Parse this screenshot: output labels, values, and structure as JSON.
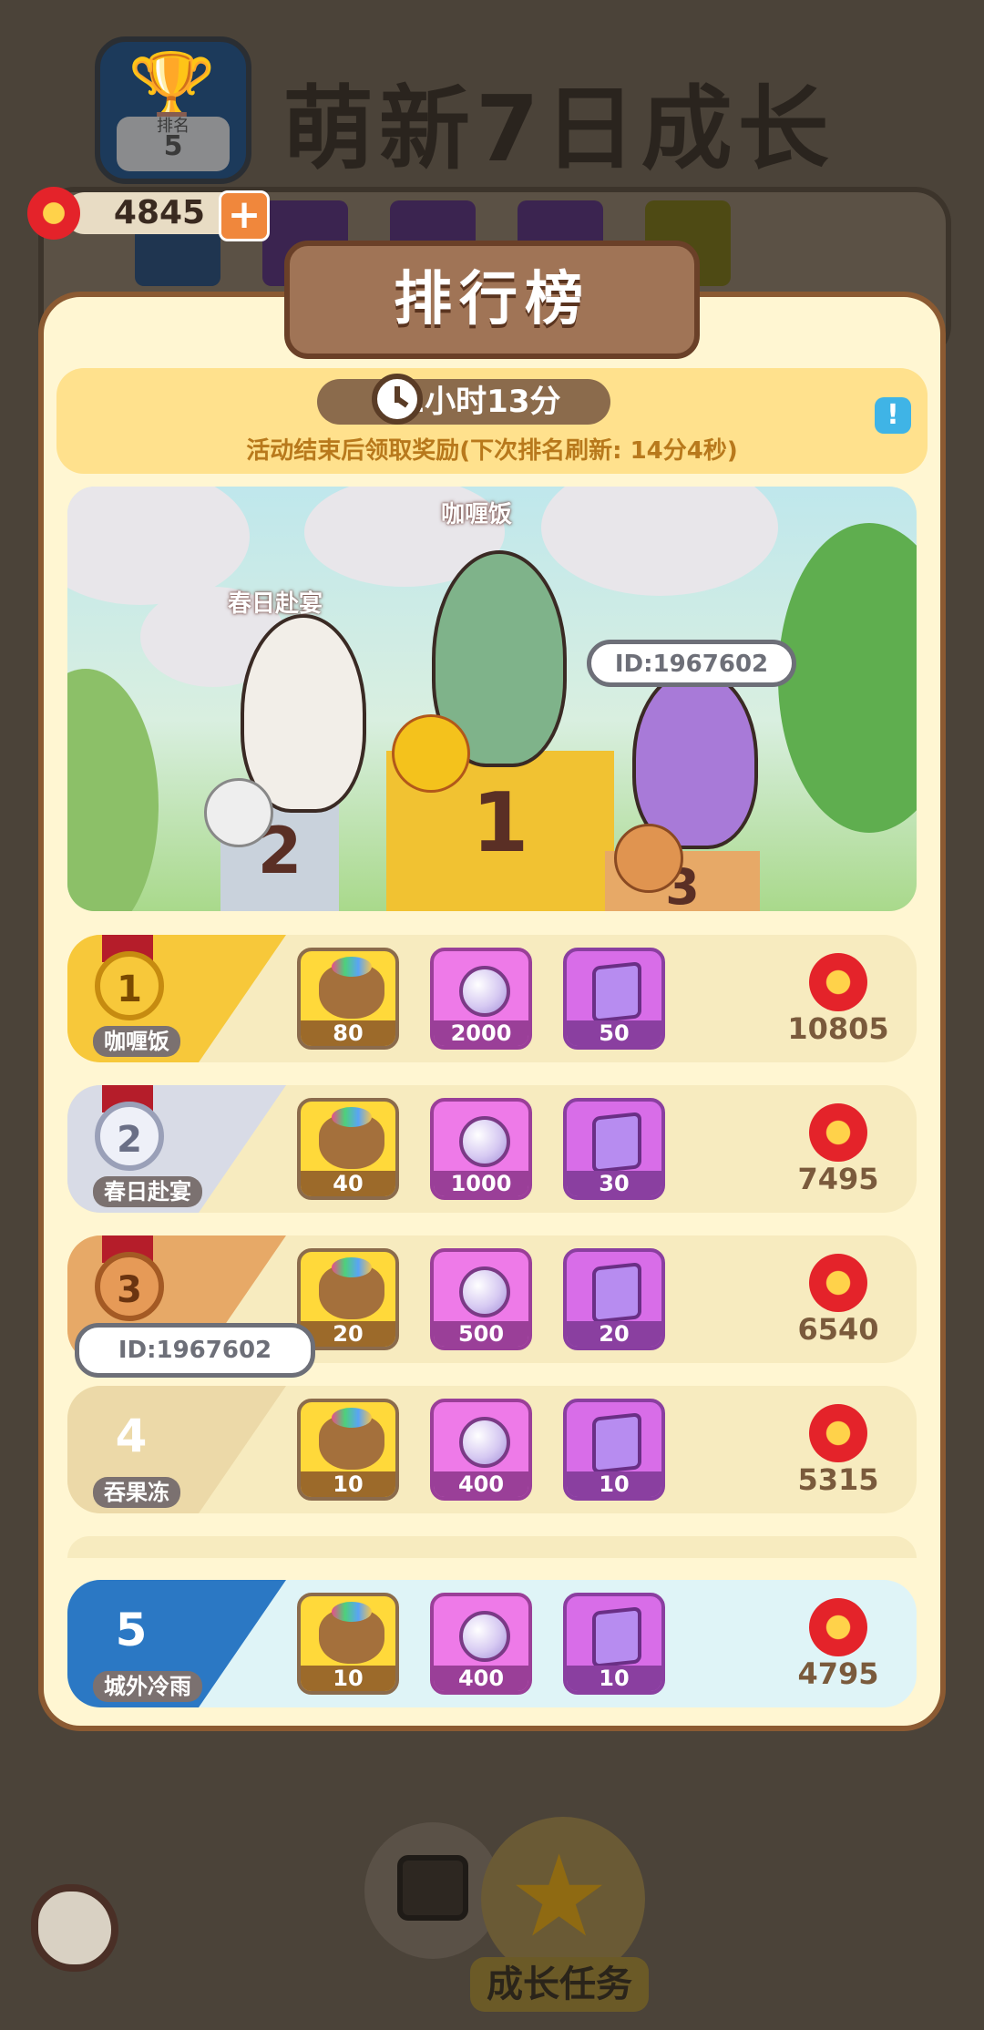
{
  "background": {
    "title": "萌新7日成长",
    "rank_badge": {
      "label": "排名",
      "value": "5"
    },
    "flower_balance": "4845"
  },
  "modal": {
    "title": "排行榜",
    "timer": "1小时13分",
    "refresh_note": "活动结束后领取奖励(下次排名刷新: 14分4秒)",
    "podium": {
      "first_name": "咖喱饭",
      "second_name": "春日赴宴",
      "third_id": "ID:1967602",
      "stand_numbers": [
        "1",
        "2",
        "3"
      ]
    },
    "rows": [
      {
        "rank": "1",
        "name": "咖喱饭",
        "rewards": [
          "80",
          "2000",
          "50"
        ],
        "score": "10805"
      },
      {
        "rank": "2",
        "name": "春日赴宴",
        "rewards": [
          "40",
          "1000",
          "30"
        ],
        "score": "7495"
      },
      {
        "rank": "3",
        "name": "ID:1967602",
        "rewards": [
          "20",
          "500",
          "20"
        ],
        "score": "6540"
      },
      {
        "rank": "4",
        "name": "吞果冻",
        "rewards": [
          "10",
          "400",
          "10"
        ],
        "score": "5315"
      }
    ],
    "my_row": {
      "rank": "5",
      "name": "城外冷雨",
      "rewards": [
        "10",
        "400",
        "10"
      ],
      "score": "4795"
    }
  },
  "bottom": {
    "task_tab_label": "成长任务"
  },
  "colors": {
    "gold": "#f7c83a",
    "silver": "#d8dbe6",
    "bronze": "#e7a967",
    "my_rank": "#2b78c4",
    "flower": "#e4232a"
  },
  "icons": [
    "trophy-icon",
    "plus-icon",
    "clock-icon",
    "info-icon",
    "flower-icon",
    "candy-bag-icon",
    "pearl-icon",
    "book-icon",
    "calendar-icon",
    "star-icon",
    "back-icon"
  ]
}
